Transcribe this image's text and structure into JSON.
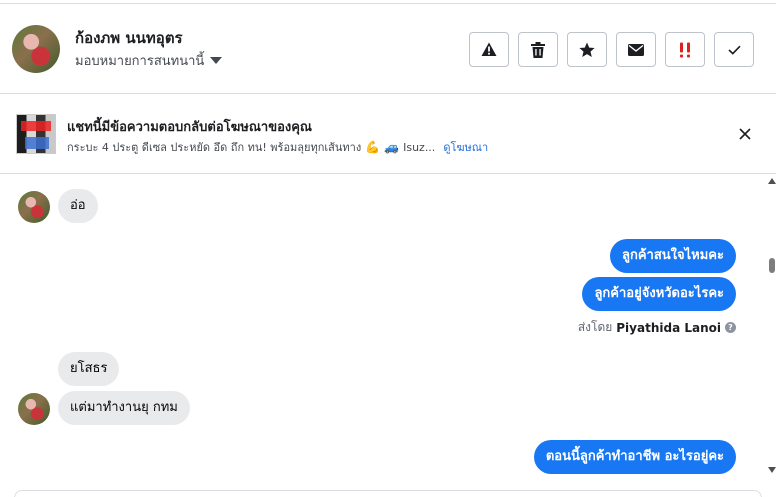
{
  "header": {
    "contact_name": "ก้องภพ นนทอุตร",
    "assign_label": "มอบหมายการสนทนานี้",
    "actions": [
      {
        "name": "report-spam-button",
        "icon": "warning-icon"
      },
      {
        "name": "delete-button",
        "icon": "trash-icon"
      },
      {
        "name": "star-button",
        "icon": "star-icon"
      },
      {
        "name": "mark-unread-button",
        "icon": "envelope-icon"
      },
      {
        "name": "follow-up-button",
        "icon": "double-exclamation-icon",
        "color": "#e02020"
      },
      {
        "name": "mark-done-button",
        "icon": "check-icon"
      }
    ]
  },
  "ad_banner": {
    "title": "แชทนี้มีข้อความตอบกลับต่อโฆษณาของคุณ",
    "subtitle": "กระบะ 4 ประตู ดีเซล ประหยัด อึด ถึก ทน! พร้อมลุยทุกเส้นทาง",
    "emoji_1": "💪",
    "emoji_2": "🚙",
    "subtitle_tail": "Isuz...",
    "view_ad_label": "ดูโฆษณา"
  },
  "messages": [
    {
      "direction": "in",
      "text": "อ่อ"
    },
    {
      "direction": "out",
      "text": "ลูกค้าสนใจไหมคะ"
    },
    {
      "direction": "out",
      "text": "ลูกค้าอยู่จังหวัดอะไรคะ"
    },
    {
      "direction": "in",
      "text": "ยโสธร"
    },
    {
      "direction": "in",
      "text": "แต่มาทำงานยุ กทม"
    },
    {
      "direction": "out",
      "text": "ตอนนี้ลูกค้าทำอาชีพ อะไรอยู่คะ"
    }
  ],
  "sent_by": {
    "prefix": "ส่งโดย",
    "agent": "Piyathida Lanoi",
    "help_glyph": "?"
  },
  "colors": {
    "outgoing_bubble": "#1877f2",
    "incoming_bubble": "#e9eaec",
    "link": "#216fdb"
  }
}
